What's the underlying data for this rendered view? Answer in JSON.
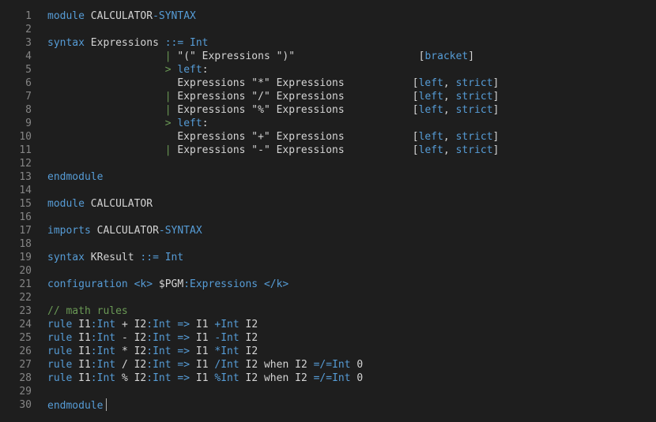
{
  "editor": {
    "lines": [
      {
        "n": "1",
        "tokens": [
          [
            "kw",
            "module "
          ],
          [
            "id",
            "CALCULATOR"
          ],
          [
            "op",
            "-"
          ],
          [
            "kw",
            "SYNTAX"
          ]
        ]
      },
      {
        "n": "2",
        "tokens": []
      },
      {
        "n": "3",
        "tokens": [
          [
            "kw",
            "syntax "
          ],
          [
            "id",
            "Expressions "
          ],
          [
            "op",
            "::= "
          ],
          [
            "kw",
            "Int"
          ]
        ]
      },
      {
        "n": "4",
        "tokens": [
          [
            "id",
            "                   "
          ],
          [
            "pipe",
            "| "
          ],
          [
            "id",
            "\"(\" Expressions \")\""
          ],
          [
            "id",
            "                    "
          ],
          [
            "br",
            "["
          ],
          [
            "att",
            "bracket"
          ],
          [
            "br",
            "]"
          ]
        ]
      },
      {
        "n": "5",
        "tokens": [
          [
            "id",
            "                   "
          ],
          [
            "pipe",
            "> "
          ],
          [
            "kw",
            "left"
          ],
          [
            "id",
            ":"
          ]
        ]
      },
      {
        "n": "6",
        "tokens": [
          [
            "id",
            "                     Expressions \"*\" Expressions           "
          ],
          [
            "br",
            "["
          ],
          [
            "att",
            "left"
          ],
          [
            "id",
            ", "
          ],
          [
            "att",
            "strict"
          ],
          [
            "br",
            "]"
          ]
        ]
      },
      {
        "n": "7",
        "tokens": [
          [
            "id",
            "                   "
          ],
          [
            "pipe",
            "| "
          ],
          [
            "id",
            "Expressions \"/\" Expressions           "
          ],
          [
            "br",
            "["
          ],
          [
            "att",
            "left"
          ],
          [
            "id",
            ", "
          ],
          [
            "att",
            "strict"
          ],
          [
            "br",
            "]"
          ]
        ]
      },
      {
        "n": "8",
        "tokens": [
          [
            "id",
            "                   "
          ],
          [
            "pipe",
            "| "
          ],
          [
            "id",
            "Expressions \"%\" Expressions           "
          ],
          [
            "br",
            "["
          ],
          [
            "att",
            "left"
          ],
          [
            "id",
            ", "
          ],
          [
            "att",
            "strict"
          ],
          [
            "br",
            "]"
          ]
        ]
      },
      {
        "n": "9",
        "tokens": [
          [
            "id",
            "                   "
          ],
          [
            "pipe",
            "> "
          ],
          [
            "kw",
            "left"
          ],
          [
            "id",
            ":"
          ]
        ]
      },
      {
        "n": "10",
        "tokens": [
          [
            "id",
            "                     Expressions \"+\" Expressions           "
          ],
          [
            "br",
            "["
          ],
          [
            "att",
            "left"
          ],
          [
            "id",
            ", "
          ],
          [
            "att",
            "strict"
          ],
          [
            "br",
            "]"
          ]
        ]
      },
      {
        "n": "11",
        "tokens": [
          [
            "id",
            "                   "
          ],
          [
            "pipe",
            "| "
          ],
          [
            "id",
            "Expressions \"-\" Expressions           "
          ],
          [
            "br",
            "["
          ],
          [
            "att",
            "left"
          ],
          [
            "id",
            ", "
          ],
          [
            "att",
            "strict"
          ],
          [
            "br",
            "]"
          ]
        ]
      },
      {
        "n": "12",
        "tokens": []
      },
      {
        "n": "13",
        "tokens": [
          [
            "kw",
            "endmodule"
          ]
        ]
      },
      {
        "n": "14",
        "tokens": []
      },
      {
        "n": "15",
        "tokens": [
          [
            "kw",
            "module "
          ],
          [
            "id",
            "CALCULATOR"
          ]
        ]
      },
      {
        "n": "16",
        "tokens": []
      },
      {
        "n": "17",
        "tokens": [
          [
            "kw",
            "imports "
          ],
          [
            "id",
            "CALCULATOR"
          ],
          [
            "op",
            "-"
          ],
          [
            "kw",
            "SYNTAX"
          ]
        ]
      },
      {
        "n": "18",
        "tokens": []
      },
      {
        "n": "19",
        "tokens": [
          [
            "kw",
            "syntax "
          ],
          [
            "id",
            "KResult "
          ],
          [
            "op",
            "::= "
          ],
          [
            "kw",
            "Int"
          ]
        ]
      },
      {
        "n": "20",
        "tokens": []
      },
      {
        "n": "21",
        "tokens": [
          [
            "kw",
            "configuration "
          ],
          [
            "kw",
            "<k> "
          ],
          [
            "id",
            "$PGM"
          ],
          [
            "op",
            ":"
          ],
          [
            "kw",
            "Expressions "
          ],
          [
            "kw",
            "</k>"
          ]
        ]
      },
      {
        "n": "22",
        "tokens": []
      },
      {
        "n": "23",
        "tokens": [
          [
            "grn",
            "// math rules"
          ]
        ]
      },
      {
        "n": "24",
        "tokens": [
          [
            "kw",
            "rule "
          ],
          [
            "id",
            "I1"
          ],
          [
            "op",
            ":"
          ],
          [
            "kw",
            "Int "
          ],
          [
            "id",
            "+ I2"
          ],
          [
            "op",
            ":"
          ],
          [
            "kw",
            "Int "
          ],
          [
            "op",
            "=> "
          ],
          [
            "id",
            "I1 "
          ],
          [
            "op",
            "+"
          ],
          [
            "kw",
            "Int "
          ],
          [
            "id",
            "I2"
          ]
        ]
      },
      {
        "n": "25",
        "tokens": [
          [
            "kw",
            "rule "
          ],
          [
            "id",
            "I1"
          ],
          [
            "op",
            ":"
          ],
          [
            "kw",
            "Int "
          ],
          [
            "id",
            "- I2"
          ],
          [
            "op",
            ":"
          ],
          [
            "kw",
            "Int "
          ],
          [
            "op",
            "=> "
          ],
          [
            "id",
            "I1 "
          ],
          [
            "op",
            "-"
          ],
          [
            "kw",
            "Int "
          ],
          [
            "id",
            "I2"
          ]
        ]
      },
      {
        "n": "26",
        "tokens": [
          [
            "kw",
            "rule "
          ],
          [
            "id",
            "I1"
          ],
          [
            "op",
            ":"
          ],
          [
            "kw",
            "Int "
          ],
          [
            "id",
            "* I2"
          ],
          [
            "op",
            ":"
          ],
          [
            "kw",
            "Int "
          ],
          [
            "op",
            "=> "
          ],
          [
            "id",
            "I1 "
          ],
          [
            "op",
            "*"
          ],
          [
            "kw",
            "Int "
          ],
          [
            "id",
            "I2"
          ]
        ]
      },
      {
        "n": "27",
        "tokens": [
          [
            "kw",
            "rule "
          ],
          [
            "id",
            "I1"
          ],
          [
            "op",
            ":"
          ],
          [
            "kw",
            "Int "
          ],
          [
            "id",
            "/ I2"
          ],
          [
            "op",
            ":"
          ],
          [
            "kw",
            "Int "
          ],
          [
            "op",
            "=> "
          ],
          [
            "id",
            "I1 "
          ],
          [
            "op",
            "/"
          ],
          [
            "kw",
            "Int "
          ],
          [
            "id",
            "I2 when I2 "
          ],
          [
            "op",
            "=/="
          ],
          [
            "kw",
            "Int "
          ],
          [
            "id",
            "0"
          ]
        ]
      },
      {
        "n": "28",
        "tokens": [
          [
            "kw",
            "rule "
          ],
          [
            "id",
            "I1"
          ],
          [
            "op",
            ":"
          ],
          [
            "kw",
            "Int "
          ],
          [
            "id",
            "% I2"
          ],
          [
            "op",
            ":"
          ],
          [
            "kw",
            "Int "
          ],
          [
            "op",
            "=> "
          ],
          [
            "id",
            "I1 "
          ],
          [
            "op",
            "%"
          ],
          [
            "kw",
            "Int "
          ],
          [
            "id",
            "I2 when I2 "
          ],
          [
            "op",
            "=/="
          ],
          [
            "kw",
            "Int "
          ],
          [
            "id",
            "0"
          ]
        ]
      },
      {
        "n": "29",
        "tokens": []
      },
      {
        "n": "30",
        "tokens": [
          [
            "kw",
            "endmodule"
          ]
        ],
        "cursor": true
      }
    ]
  }
}
